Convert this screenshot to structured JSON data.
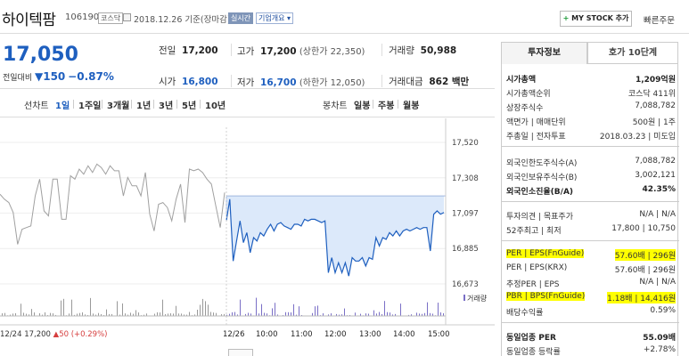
{
  "header": {
    "company": "하이텍팜",
    "code": "106190",
    "market": "코스닥",
    "date": "2018.12.26 기준(장마감)",
    "realtime": "실시간",
    "company_info": "기업개요",
    "mystock": "MY STOCK 추가",
    "fast_quote": "빠른주문"
  },
  "price": {
    "current": "17,050",
    "prev_label": "전일대비",
    "change": "150",
    "change_pct": "−0.87%"
  },
  "summary": {
    "prev_close_label": "전일",
    "prev_close": "17,200",
    "high_label": "고가",
    "high": "17,200",
    "upper_limit": "(상한가 22,350)",
    "volume_label": "거래량",
    "volume": "50,988",
    "open_label": "시가",
    "open": "16,800",
    "low_label": "저가",
    "low": "16,700",
    "lower_limit": "(하한가 12,050)",
    "amount_label": "거래대금",
    "amount": "862 백만"
  },
  "period": {
    "line_chart": "선차트",
    "tabs": [
      "1일",
      "1주일",
      "3개월",
      "1년",
      "3년",
      "5년",
      "10년"
    ],
    "candle": "봉차트",
    "candle_tabs": [
      "일봉",
      "주봉",
      "월봉"
    ]
  },
  "chart": {
    "y_ticks": [
      "17,520",
      "17,308",
      "17,097",
      "16,885",
      "16,673"
    ],
    "volume_label": "거래량",
    "prev_info": "12/24  17,200 ▲50 (+0.29%)",
    "x_ticks": [
      "12/26",
      "10:00",
      "11:00",
      "12:00",
      "13:00",
      "14:00",
      "15:00"
    ]
  },
  "chart_data": {
    "type": "line",
    "y_ticks": [
      17520,
      17308,
      17097,
      16885,
      16673
    ],
    "ylim": [
      16673,
      17520
    ],
    "x_ticks": [
      "12/26",
      "10:00",
      "11:00",
      "12:00",
      "13:00",
      "14:00",
      "15:00"
    ],
    "prev_day_close": 17200,
    "prev_day_series": [
      17210,
      17180,
      17160,
      17100,
      16910,
      17000,
      17010,
      17020,
      17200,
      17300,
      17110,
      17080,
      17300,
      17300,
      17060,
      17060,
      17320,
      17300,
      17360,
      17330,
      17380,
      17340,
      17390,
      17370,
      17330,
      17380,
      17350,
      17350,
      17200,
      17310,
      17260,
      17260,
      17200,
      17340,
      17090,
      16990,
      17150,
      17160,
      17130,
      17050,
      17180,
      17270,
      17040,
      17360,
      17350,
      17360,
      17340,
      17300,
      17270,
      17140,
      17010,
      17220
    ],
    "today_series": [
      17050,
      17180,
      16810,
      16930,
      17050,
      16920,
      16980,
      16860,
      16950,
      16930,
      16980,
      16960,
      17000,
      17030,
      16990,
      17030,
      17040,
      17020,
      17010,
      17000,
      17030,
      17030,
      17020,
      17060,
      17050,
      17060,
      17060,
      17050,
      17040,
      17050,
      16740,
      16830,
      16740,
      16800,
      16740,
      16800,
      16720,
      16830,
      16810,
      16810,
      16830,
      16780,
      16830,
      16820,
      16950,
      16900,
      16950,
      16940,
      16980,
      16960,
      16990,
      16960,
      16990,
      17000,
      16990,
      17000,
      17010,
      17000,
      17010,
      17010,
      16870,
      17090,
      17110,
      17090,
      17100
    ]
  },
  "panel": {
    "tab_invest": "투자정보",
    "tab_quote": "호가 10단계",
    "rows1": [
      {
        "k": "시가총액",
        "v": "1,209억원",
        "bold": true
      },
      {
        "k": "시가총액순위",
        "v": "코스닥 411위"
      },
      {
        "k": "상장주식수",
        "v": "7,088,782"
      },
      {
        "k": "액면가 | 매매단위",
        "v": "500원 | 1주"
      },
      {
        "k": "주총일 | 전자투표",
        "v": "2018.03.23 | 미도입"
      }
    ],
    "rows2": [
      {
        "k": "외국인한도주식수(A)",
        "v": "7,088,782"
      },
      {
        "k": "외국인보유주식수(B)",
        "v": "3,002,121"
      },
      {
        "k": "외국인소진율(B/A)",
        "v": "42.35%",
        "bold": true
      }
    ],
    "rows3": [
      {
        "k": "투자의견 | 목표주가",
        "v": "N/A | N/A"
      },
      {
        "k": "52주최고 | 최저",
        "v": "17,800 | 10,750"
      }
    ],
    "rows4": [
      {
        "k": "PER | EPS(FnGuide)",
        "v": "57.60배 | 296원"
      },
      {
        "k": "PER | EPS(KRX)",
        "v": "57.60배 | 296원"
      },
      {
        "k": "추정PER | EPS",
        "v": "N/A | N/A"
      },
      {
        "k": "PBR | BPS(FnGuide)",
        "v": "1.18배 | 14,416원"
      },
      {
        "k": "배당수익률",
        "v": "0.59%"
      }
    ],
    "rows5": [
      {
        "k": "동일업종 PER",
        "v": "55.09배",
        "bold": true
      },
      {
        "k": "동일업종 등락률",
        "v": "+2.78%",
        "red": true
      }
    ]
  },
  "colors": {
    "accent_blue": "#1e5fbf",
    "red": "#d63e3e",
    "highlight": "#ffff00",
    "chart_fill": "#dce9fa"
  }
}
